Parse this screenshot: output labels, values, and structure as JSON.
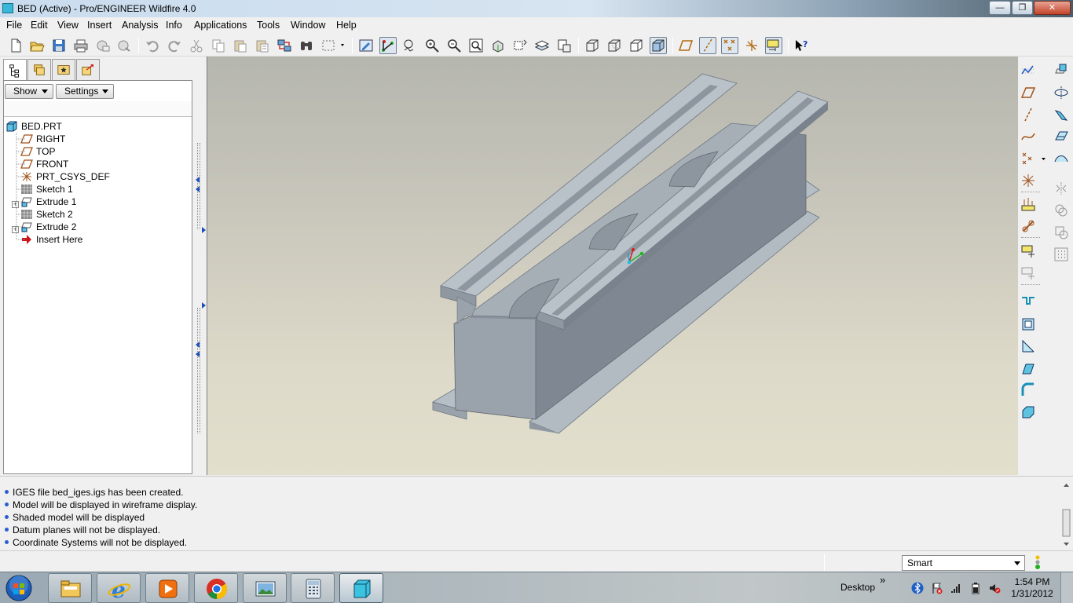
{
  "window": {
    "title": "BED (Active) - Pro/ENGINEER Wildfire 4.0",
    "minimize_glyph": "—",
    "maximize_glyph": "❐",
    "close_glyph": "✕"
  },
  "menu": {
    "items": [
      "File",
      "Edit",
      "View",
      "Insert",
      "Analysis",
      "Info",
      "Applications",
      "Tools",
      "Window",
      "Help"
    ]
  },
  "toolbar": {
    "icons": [
      "new-icon",
      "open-icon",
      "save-icon",
      "print-icon",
      "email-icon",
      "email-link-icon",
      "undo-icon",
      "redo-icon",
      "cut-icon",
      "copy-icon",
      "paste-icon",
      "paste-special-icon",
      "regenerate-icon",
      "find-icon",
      "select-box-icon",
      "repaint-icon",
      "spin-center-icon",
      "orient-mode-icon",
      "zoom-in-icon",
      "zoom-out-icon",
      "refit-icon",
      "reorient-icon",
      "saved-views-icon",
      "layers-icon",
      "view-manager-icon",
      "wireframe-icon",
      "hidden-line-icon",
      "no-hidden-icon",
      "shading-icon",
      "datum-planes-icon",
      "datum-axes-icon",
      "datum-points-icon",
      "coordinate-systems-icon",
      "annotations-icon",
      "context-help-icon"
    ]
  },
  "model_tree": {
    "tabs": [
      "model-tree-tab",
      "folder-browser-tab",
      "favorites-tab",
      "connections-tab"
    ],
    "show_label": "Show",
    "settings_label": "Settings",
    "items": [
      {
        "label": "BED.PRT",
        "icon": "part-icon",
        "level": 0,
        "expandable": false
      },
      {
        "label": "RIGHT",
        "icon": "datum-plane-icon",
        "level": 1,
        "expandable": false
      },
      {
        "label": "TOP",
        "icon": "datum-plane-icon",
        "level": 1,
        "expandable": false
      },
      {
        "label": "FRONT",
        "icon": "datum-plane-icon",
        "level": 1,
        "expandable": false
      },
      {
        "label": "PRT_CSYS_DEF",
        "icon": "csys-icon",
        "level": 1,
        "expandable": false
      },
      {
        "label": "Sketch 1",
        "icon": "sketch-icon",
        "level": 1,
        "expandable": false
      },
      {
        "label": "Extrude 1",
        "icon": "extrude-icon",
        "level": 1,
        "expandable": true
      },
      {
        "label": "Sketch 2",
        "icon": "sketch-icon",
        "level": 1,
        "expandable": false
      },
      {
        "label": "Extrude 2",
        "icon": "extrude-icon",
        "level": 1,
        "expandable": true
      },
      {
        "label": "Insert Here",
        "icon": "insert-arrow-icon",
        "level": 1,
        "expandable": false
      }
    ]
  },
  "right_toolbar": {
    "col1": [
      "sketch-tool-icon",
      "datum-plane-tool-icon",
      "datum-axis-tool-icon",
      "datum-curve-tool-icon",
      "datum-point-tool-icon",
      "csys-tool-icon",
      "analysis-tool-icon",
      "connect-tool-icon",
      "annotation-tool-icon",
      "annotation-edit-icon",
      "hole-tool-icon",
      "shell-tool-icon",
      "rib-tool-icon",
      "draft-tool-icon",
      "round-tool-icon",
      "chamfer-tool-icon"
    ],
    "col2": [
      "extrude-tool-icon",
      "revolve-tool-icon",
      "variable-sweep-icon",
      "blend-tool-icon",
      "style-tool-icon",
      "mirror-tool-icon",
      "merge-tool-icon",
      "trim-tool-icon",
      "pattern-tool-icon"
    ]
  },
  "messages": [
    "IGES file bed_iges.igs has been created.",
    "Model will be displayed in wireframe display.",
    "Shaded model will be displayed",
    "Datum planes will not be displayed.",
    "Coordinate Systems will not be displayed."
  ],
  "statusbar": {
    "filter_value": "Smart"
  },
  "taskbar": {
    "apps": [
      "file-explorer-icon",
      "internet-explorer-icon",
      "media-player-icon",
      "chrome-icon",
      "photo-viewer-icon",
      "calculator-icon",
      "pro-engineer-icon"
    ],
    "desktop_label": "Desktop",
    "toolbar_chevron": "»",
    "time": "1:54 PM",
    "date": "1/31/2012"
  },
  "colors": {
    "model_face_top": "#a8b0b8",
    "model_face_side": "#7f8892",
    "accent_blue": "#2a5fd0"
  }
}
